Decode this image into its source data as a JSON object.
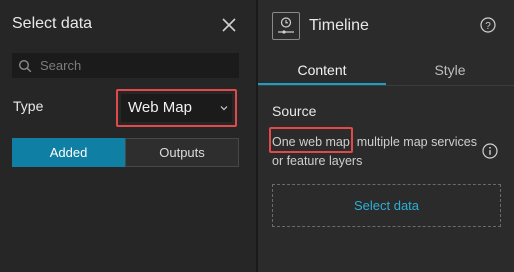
{
  "left_panel": {
    "title": "Select data",
    "close_icon": "close-icon",
    "search": {
      "placeholder": "Search",
      "value": "",
      "icon": "search-icon"
    },
    "type": {
      "label": "Type",
      "selected": "Web Map",
      "icon": "chevron-down-icon"
    },
    "segmented": {
      "added_label": "Added",
      "outputs_label": "Outputs",
      "active": "Added"
    }
  },
  "right_panel": {
    "title": "Timeline",
    "widget_icon": "timeline-icon",
    "help_icon": "help-icon",
    "tabs": [
      {
        "label": "Content",
        "active": true
      },
      {
        "label": "Style",
        "active": false
      }
    ],
    "source": {
      "label": "Source",
      "text": "One web map, multiple map services or feature layers",
      "info_icon": "info-icon"
    },
    "select_data_label": "Select data"
  },
  "colors": {
    "accent": "#0f7fa3",
    "link": "#2ab0d6",
    "highlight": "#e04a4a",
    "background": "#262626"
  }
}
